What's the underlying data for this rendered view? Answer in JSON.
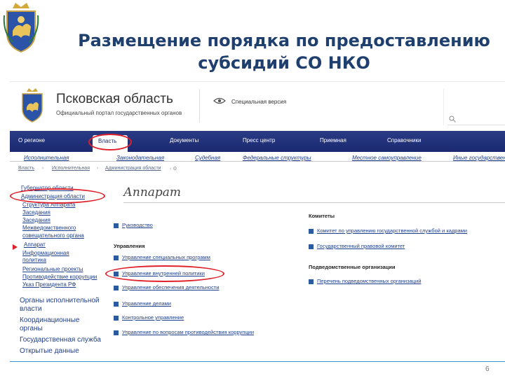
{
  "slide": {
    "title_line1": "Размещение порядка по предоставлению",
    "title_line2": "субсидий СО НКО",
    "page_number": "6"
  },
  "site": {
    "name": "Псковская область",
    "subtitle": "Официальный портал государственных органов",
    "special_version": "Специальная версия",
    "nav": [
      "О регионе",
      "Власть",
      "Документы",
      "Пресс центр",
      "Приемная",
      "Справочники"
    ],
    "nav_active": "Власть",
    "subnav": [
      "Исполнительная",
      "Законодательная",
      "Судебная",
      "Федеральные структуры",
      "Местное самоуправление",
      "Иные государственные"
    ],
    "breadcrumb": [
      "Власть",
      "Исполнительная",
      "Администрация области"
    ],
    "sidebar": [
      "Губернатор области",
      "Администрация области",
      "Структура Аппарата",
      "Заседания",
      "Заседания",
      "Межведомственного",
      "совещательного органа",
      "Аппарат",
      "Информационная",
      "политика",
      "Региональные проекты",
      "Противодействие коррупции",
      "Указ Президента РФ"
    ],
    "sidebar_big": [
      "Органы исполнительной",
      "власти",
      "Координационные",
      "органы",
      "Государственная служба",
      "Открытые данные"
    ],
    "heading": "Аппарат",
    "left_links": {
      "rukovodstvo": "Руководство",
      "upravleniya_label": "Управления",
      "items": [
        "Управление специальных программ",
        "Управление внутренней политики",
        "Управление обеспечения деятельности",
        "Управление делами",
        "Контрольное управление",
        "Управление по вопросам противодействия коррупции"
      ]
    },
    "right": {
      "komitety_label": "Комитеты",
      "komitety": [
        "Комитет по управлению государственной службой и кадрами",
        "Государственный правовой комитет"
      ],
      "podved_label": "Подведомственные организации",
      "podved": [
        "Перечень подведомственных организаций"
      ]
    }
  }
}
